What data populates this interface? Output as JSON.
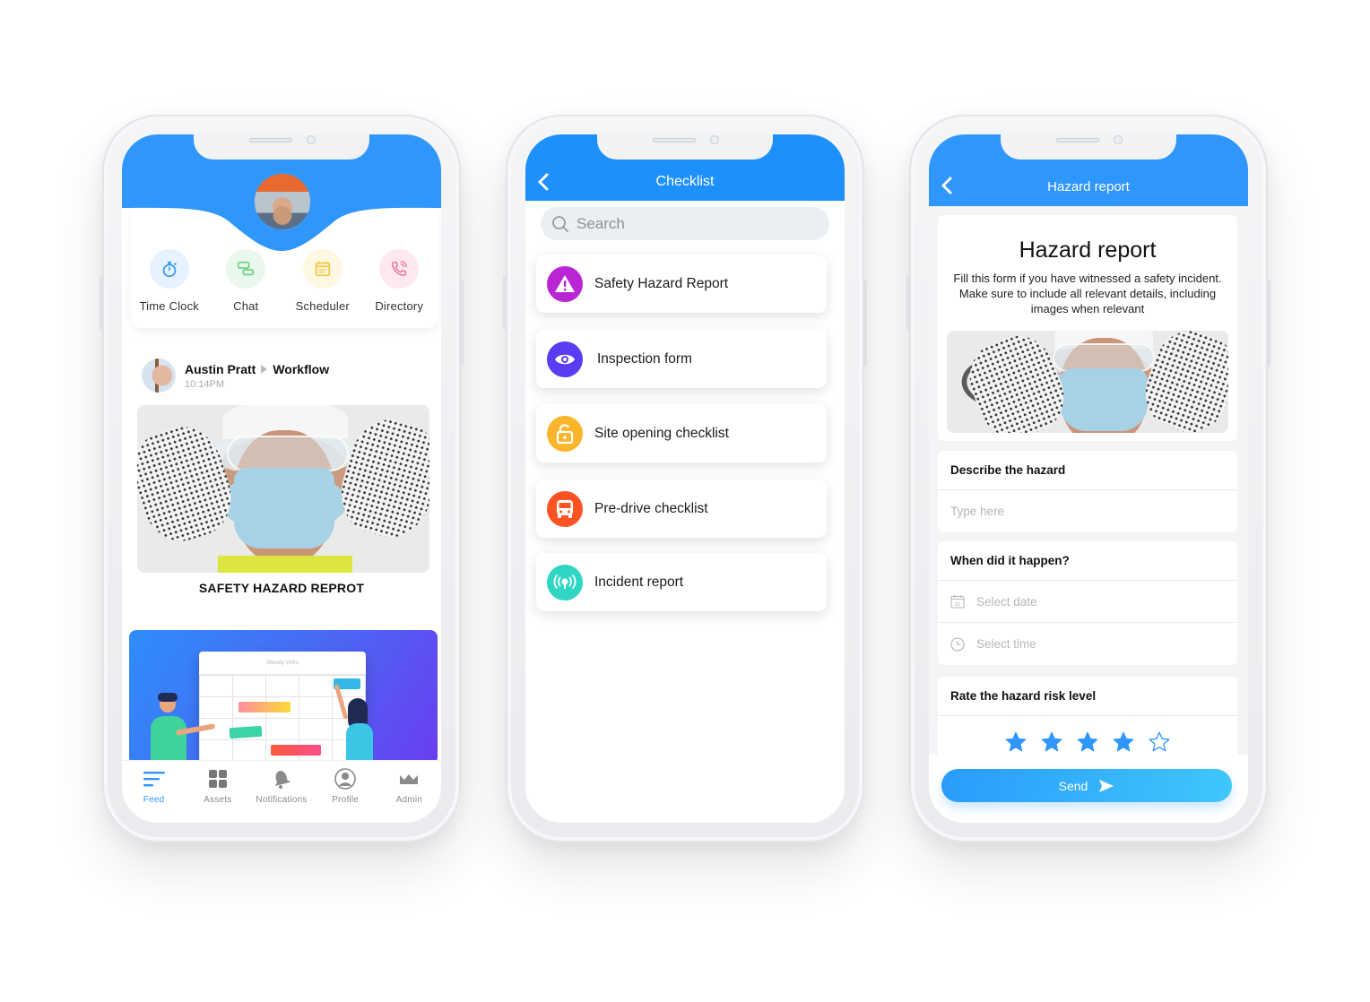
{
  "feed_screen": {
    "quick_actions": [
      {
        "label": "Time Clock",
        "icon": "stopwatch-icon",
        "color": "#3d9bf7",
        "bg": "#e6f2fe"
      },
      {
        "label": "Chat",
        "icon": "chat-bubbles-icon",
        "color": "#6bcf7d",
        "bg": "#e9f7ec"
      },
      {
        "label": "Scheduler",
        "icon": "calendar-icon",
        "color": "#f6c536",
        "bg": "#fef7e2"
      },
      {
        "label": "Directory",
        "icon": "phone-call-icon",
        "color": "#ec6a8e",
        "bg": "#fde9ef"
      }
    ],
    "post": {
      "author": "Austin Pratt",
      "target": "Workflow",
      "time": "10:14PM",
      "caption": "SAFETY HAZARD REPROT"
    },
    "shift_card": {
      "board_title": "Weekly shifts"
    },
    "tabs": [
      {
        "label": "Feed",
        "icon": "feed-lines-icon",
        "active": true
      },
      {
        "label": "Assets",
        "icon": "grid-icon",
        "active": false
      },
      {
        "label": "Notifications",
        "icon": "bell-icon",
        "active": false
      },
      {
        "label": "Profile",
        "icon": "user-circle-icon",
        "active": false
      },
      {
        "label": "Admin",
        "icon": "crown-icon",
        "active": false
      }
    ],
    "colors": {
      "accent": "#2f96fc",
      "inactive": "#8a8a8a"
    }
  },
  "checklist_screen": {
    "title": "Checklist",
    "search_placeholder": "Search",
    "items": [
      {
        "label": "Safety Hazard Report",
        "icon": "warning-triangle-icon",
        "color": "#b926d4"
      },
      {
        "label": "Inspection form",
        "icon": "eye-icon",
        "color": "#5a3cf2"
      },
      {
        "label": "Site opening checklist",
        "icon": "unlock-icon",
        "color": "#fbb52b"
      },
      {
        "label": "Pre-drive checklist",
        "icon": "bus-icon",
        "color": "#fb5324"
      },
      {
        "label": "Incident report",
        "icon": "broadcast-icon",
        "color": "#2fd6c3"
      }
    ],
    "colors": {
      "header": "#1e90fc"
    }
  },
  "hazard_screen": {
    "title": "Hazard report",
    "intro_title": "Hazard report",
    "intro_desc": "Fill this form if you have witnessed a safety incident. Make sure to include all relevant details, including images when relevant",
    "describe_label": "Describe the  hazard",
    "describe_placeholder": "Type here",
    "when_label": "When did it happen?",
    "date_placeholder": "Select date",
    "time_placeholder": "Select time",
    "rating_label": "Rate the hazard risk level",
    "rating": {
      "value": 4,
      "max": 5
    },
    "send_label": "Send",
    "colors": {
      "header": "#2f96fc",
      "star": "#2f96fc"
    }
  }
}
